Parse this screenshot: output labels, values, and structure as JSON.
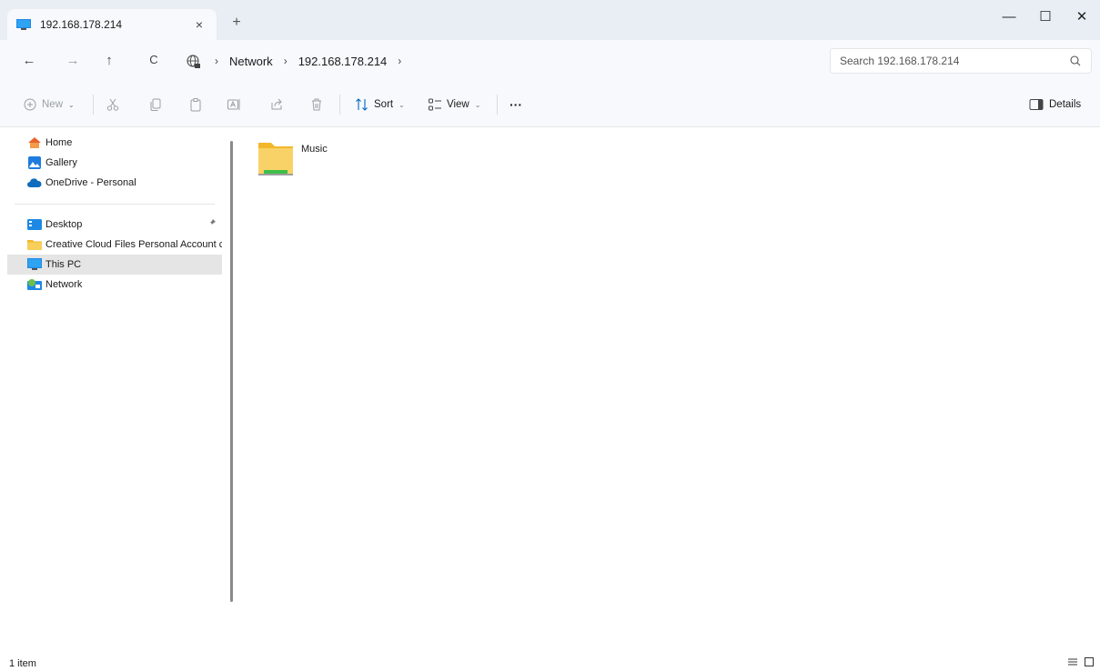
{
  "tab": {
    "title": "192.168.178.214",
    "close": "×",
    "new_tab": "+"
  },
  "window_controls": {
    "minimize": "—",
    "maximize": "☐",
    "close": "✕"
  },
  "nav": {
    "back": "←",
    "forward": "→",
    "up": "↑",
    "refresh": "C"
  },
  "breadcrumb": {
    "items": [
      "Network",
      "192.168.178.214"
    ],
    "separator": "›"
  },
  "search": {
    "placeholder": "Search 192.168.178.214"
  },
  "commands": {
    "new_label": "New",
    "sort_label": "Sort",
    "view_label": "View",
    "more_label": "···",
    "details_label": "Details",
    "chevron": "⌄"
  },
  "sidebar": {
    "items": [
      {
        "label": "Home",
        "icon": "home-icon"
      },
      {
        "label": "Gallery",
        "icon": "gallery-icon"
      },
      {
        "label": "OneDrive - Personal",
        "icon": "onedrive-icon"
      },
      {
        "label": "Desktop",
        "icon": "desktop-icon",
        "pinned": true
      },
      {
        "label": "Creative Cloud Files Personal Account c",
        "icon": "folder-icon"
      },
      {
        "label": "This PC",
        "icon": "this-pc-icon",
        "selected": true
      },
      {
        "label": "Network",
        "icon": "network-icon"
      }
    ],
    "pin": "📌"
  },
  "content": {
    "items": [
      {
        "label": "Music",
        "icon": "network-share-folder-icon"
      }
    ]
  },
  "status": {
    "count": "1 item"
  },
  "colors": {
    "accent": "#0067c0",
    "folder": "#f5c842",
    "share_bar": "#3cbf4a",
    "selected": "#e5e5e5"
  }
}
